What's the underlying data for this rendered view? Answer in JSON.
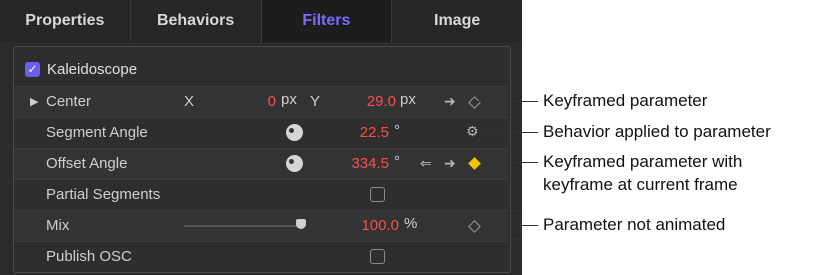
{
  "tabs": [
    {
      "label": "Properties"
    },
    {
      "label": "Behaviors"
    },
    {
      "label": "Filters"
    },
    {
      "label": "Image"
    }
  ],
  "filter": {
    "name": "Kaleidoscope"
  },
  "params": {
    "center": {
      "label": "Center",
      "x_axis": "X",
      "x_value": "0",
      "x_unit": "px",
      "y_axis": "Y",
      "y_value": "29.0",
      "y_unit": "px"
    },
    "segment_angle": {
      "label": "Segment Angle",
      "value": "22.5",
      "unit": "°"
    },
    "offset_angle": {
      "label": "Offset Angle",
      "value": "334.5",
      "unit": "°"
    },
    "partial_segments": {
      "label": "Partial Segments"
    },
    "mix": {
      "label": "Mix",
      "value": "100.0",
      "unit": "%",
      "slider_fraction": 0.94
    },
    "publish_osc": {
      "label": "Publish OSC"
    }
  },
  "callouts": {
    "keyframed": "Keyframed parameter",
    "behavior": "Behavior applied to parameter",
    "keyframe_current_line1": "Keyframed parameter with",
    "keyframe_current_line2": "keyframe at current frame",
    "not_animated": "Parameter not animated"
  },
  "colors": {
    "accent": "#7c6bff",
    "value_red": "#ff4d4d",
    "keyframe_yellow": "#f6c400"
  }
}
